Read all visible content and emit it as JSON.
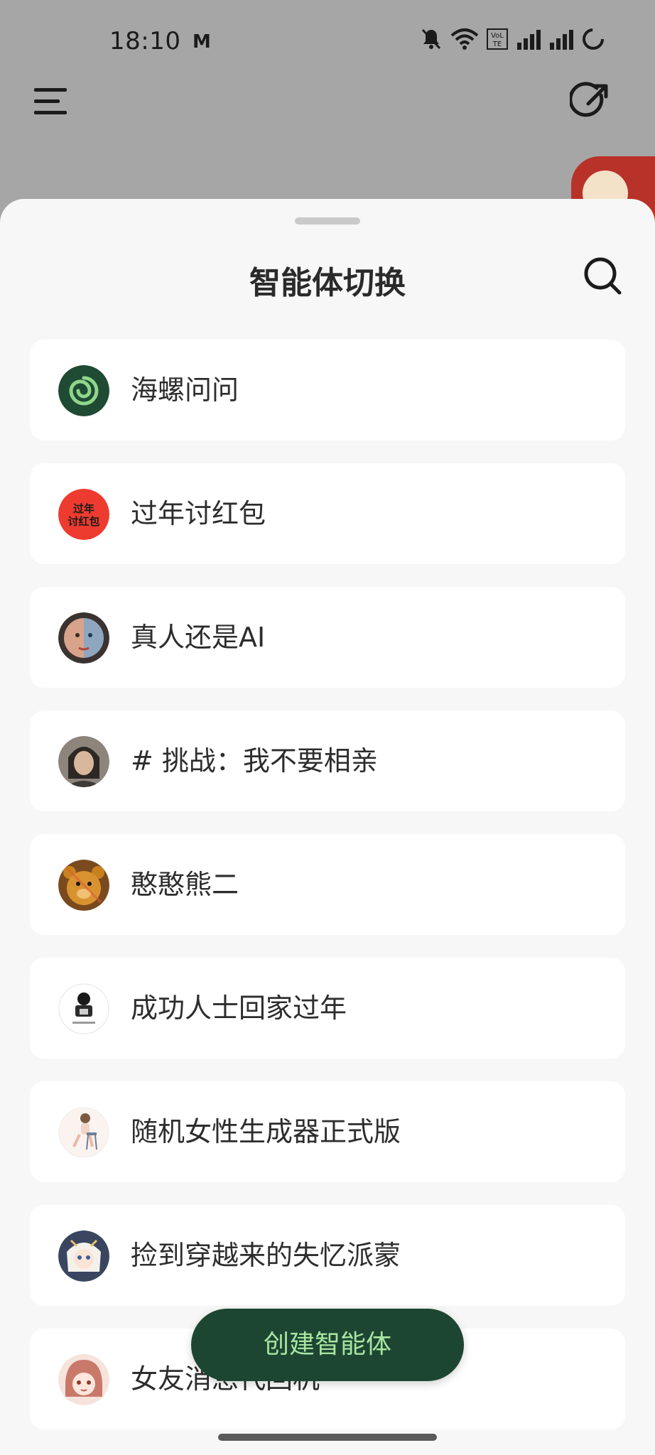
{
  "status_bar": {
    "time": "18:10",
    "mail_glyph": "M",
    "network_label": "VoLTE"
  },
  "topbar": {
    "menu_icon": "hamburger-menu-icon",
    "new_chat_icon": "external-arrow-icon"
  },
  "sheet": {
    "title": "智能体切换",
    "search_icon": "search-icon"
  },
  "agents": [
    {
      "name": "海螺问问",
      "avatar_text": "",
      "avatar_color": "#1f4a33"
    },
    {
      "name": "过年讨红包",
      "avatar_text": "过年\n讨红包",
      "avatar_color": "#ee3b2f"
    },
    {
      "name": "真人还是AI",
      "avatar_text": "",
      "avatar_color": "#8a7d77"
    },
    {
      "name": "# 挑战：我不要相亲",
      "avatar_text": "",
      "avatar_color": "#6f6a64"
    },
    {
      "name": "憨憨熊二",
      "avatar_text": "",
      "avatar_color": "#c8821d"
    },
    {
      "name": "成功人士回家过年",
      "avatar_text": "",
      "avatar_color": "#ffffff"
    },
    {
      "name": "随机女性生成器正式版",
      "avatar_text": "",
      "avatar_color": "#fbf3ef"
    },
    {
      "name": "捡到穿越来的失忆派蒙",
      "avatar_text": "",
      "avatar_color": "#3a4560"
    },
    {
      "name": "女友消息代回机",
      "avatar_text": "",
      "avatar_color": "#c9796a"
    }
  ],
  "create_button": {
    "label": "创建智能体"
  },
  "colors": {
    "accent": "#1d4632",
    "accent_text": "#a9e5a1",
    "sheet_bg": "#f7f7f7",
    "card_bg": "#ffffff"
  }
}
